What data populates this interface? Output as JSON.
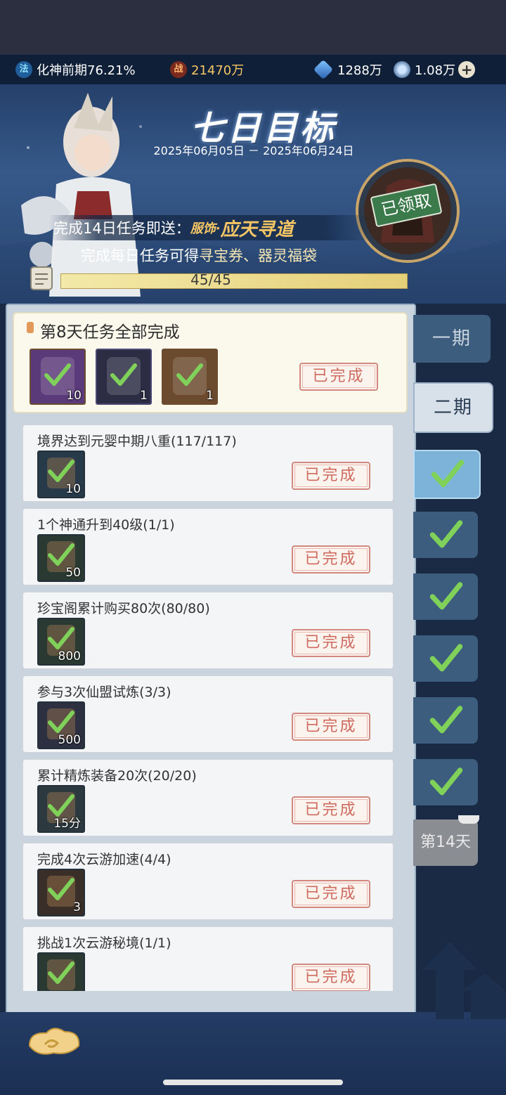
{
  "resources": {
    "realm": "化神前期76.21%",
    "realm_icon_char": "法",
    "power": "21470万",
    "power_icon_char": "战",
    "crystal": "1288万",
    "coin": "1.08万",
    "add_icon": "plus-icon"
  },
  "banner": {
    "title": "七日目标",
    "date_range": "2025年06月05日 － 2025年06月24日",
    "line1_prefix": "完成14日任务即送：",
    "line1_reward_type": "服饰·",
    "line1_reward_name": "应天寻道",
    "line2_prefix": "完成每日任务可得",
    "line2_rewards": "寻宝券、器灵福袋",
    "claim_status": "已领取",
    "progress_text": "45/45",
    "progress_fraction": 1.0
  },
  "day_summary": {
    "title": "第8天任务全部完成",
    "rewards": [
      {
        "icon": "purple-ticket-icon",
        "count": "10"
      },
      {
        "icon": "spirit-orb-icon",
        "count": "1"
      },
      {
        "icon": "treasure-chest-icon",
        "count": "1"
      }
    ],
    "status": "已完成"
  },
  "tasks": [
    {
      "name": "境界达到元婴中期八重(117/117)",
      "icon": "scroll-icon",
      "count": "10",
      "status": "已完成"
    },
    {
      "name": "1个神通升到40级(1/1)",
      "icon": "book-icon",
      "count": "50",
      "status": "已完成"
    },
    {
      "name": "珍宝阁累计购买80次(80/80)",
      "icon": "pouch-icon",
      "count": "800",
      "status": "已完成"
    },
    {
      "name": "参与3次仙盟试炼(3/3)",
      "icon": "cards-icon",
      "count": "500",
      "status": "已完成"
    },
    {
      "name": "累计精炼装备20次(20/20)",
      "icon": "tome-icon",
      "count": "15分",
      "status": "已完成"
    },
    {
      "name": "完成4次云游加速(4/4)",
      "icon": "crystal-icon",
      "count": "3",
      "status": "已完成"
    },
    {
      "name": "挑战1次云游秘境(1/1)",
      "icon": "scroll-icon",
      "count": "",
      "status": "已完成"
    }
  ],
  "period_tabs": [
    "一期",
    "二期"
  ],
  "day_tabs_completed": 6,
  "day_tab_current": "第14天",
  "colors": {
    "check_green": "#7fd15a",
    "done_red": "#cf6a5e",
    "gold": "#f6c664",
    "progress_fill": "#e9dc95"
  }
}
